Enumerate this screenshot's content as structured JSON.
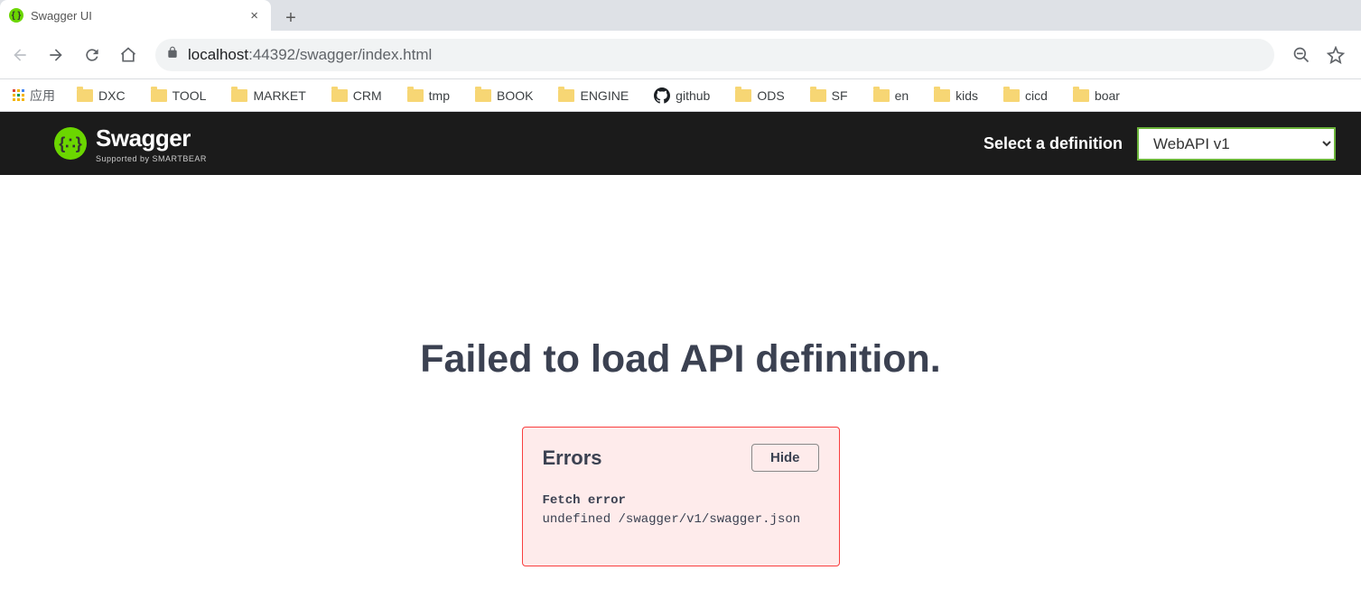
{
  "browser": {
    "tab": {
      "title": "Swagger UI"
    },
    "url_host": "localhost",
    "url_port_path": ":44392/swagger/index.html"
  },
  "bookmarks": {
    "apps_label": "应用",
    "items": [
      {
        "label": "DXC",
        "icon": "folder"
      },
      {
        "label": "TOOL",
        "icon": "folder"
      },
      {
        "label": "MARKET",
        "icon": "folder"
      },
      {
        "label": "CRM",
        "icon": "folder"
      },
      {
        "label": "tmp",
        "icon": "folder"
      },
      {
        "label": "BOOK",
        "icon": "folder"
      },
      {
        "label": "ENGINE",
        "icon": "folder"
      },
      {
        "label": "github",
        "icon": "github"
      },
      {
        "label": "ODS",
        "icon": "folder"
      },
      {
        "label": "SF",
        "icon": "folder"
      },
      {
        "label": "en",
        "icon": "folder"
      },
      {
        "label": "kids",
        "icon": "folder"
      },
      {
        "label": "cicd",
        "icon": "folder"
      },
      {
        "label": "boar",
        "icon": "folder"
      }
    ]
  },
  "swagger": {
    "brand": "Swagger",
    "supported_by": "Supported by SMARTBEAR",
    "select_label": "Select a definition",
    "definition_selected": "WebAPI v1"
  },
  "page": {
    "heading": "Failed to load API definition.",
    "errors_title": "Errors",
    "hide_label": "Hide",
    "fetch_error_title": "Fetch error",
    "fetch_error_detail": "undefined /swagger/v1/swagger.json"
  }
}
